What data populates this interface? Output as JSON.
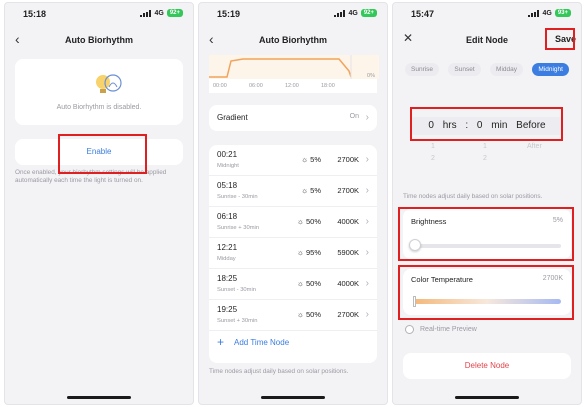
{
  "panel1": {
    "time": "15:18",
    "network": "4G",
    "battery": "92+",
    "title": "Auto Biorhythm",
    "disabled_msg": "Auto Biorhythm is disabled.",
    "enable_label": "Enable",
    "hint": "Once enabled, your biorhythm settings will be applied automatically each time the light is turned on."
  },
  "panel2": {
    "time": "15:19",
    "network": "4G",
    "battery": "92+",
    "title": "Auto Biorhythm",
    "chart_pct": "0%",
    "chart_ticks": [
      "00:00",
      "06:00",
      "12:00",
      "18:00"
    ],
    "gradient_label": "Gradient",
    "gradient_value": "On",
    "nodes": [
      {
        "time": "00:21",
        "sub": "Midnight",
        "brightness": "5%",
        "temp": "2700K"
      },
      {
        "time": "05:18",
        "sub": "Sunrise - 30min",
        "brightness": "5%",
        "temp": "2700K"
      },
      {
        "time": "06:18",
        "sub": "Sunrise + 30min",
        "brightness": "50%",
        "temp": "4000K"
      },
      {
        "time": "12:21",
        "sub": "Midday",
        "brightness": "95%",
        "temp": "5900K"
      },
      {
        "time": "18:25",
        "sub": "Sunset - 30min",
        "brightness": "50%",
        "temp": "4000K"
      },
      {
        "time": "19:25",
        "sub": "Sunset + 30min",
        "brightness": "50%",
        "temp": "2700K"
      }
    ],
    "add_label": "Add Time Node",
    "footer": "Time nodes adjust daily based on solar positions."
  },
  "panel3": {
    "time": "15:47",
    "network": "4G",
    "battery": "93+",
    "title": "Edit Node",
    "save_label": "Save",
    "segments": [
      "Sunrise",
      "Sunset",
      "Midday",
      "Midnight"
    ],
    "active_segment": "Midnight",
    "picker_selected": "0 hrs : 0 min Before",
    "picker_below": [
      "1",
      "1",
      "After"
    ],
    "picker_below2": [
      "2",
      "2"
    ],
    "tip": "Time nodes adjust daily based on solar positions.",
    "brightness_label": "Brightness",
    "brightness_value": "5%",
    "ct_label": "Color Temperature",
    "ct_value": "2700K",
    "preview_label": "Real-time Preview",
    "delete_label": "Delete Node"
  }
}
